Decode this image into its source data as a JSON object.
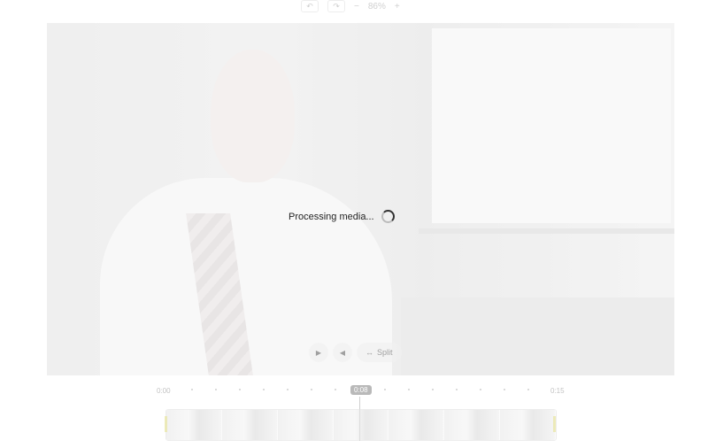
{
  "toolbar": {
    "zoom": "86%",
    "minus": "−",
    "plus": "+"
  },
  "preview": {
    "status_text": "Processing media..."
  },
  "controls": {
    "split_label": "Split"
  },
  "timeline": {
    "start": "0:00",
    "playhead": "0:08",
    "end": "0:15"
  }
}
